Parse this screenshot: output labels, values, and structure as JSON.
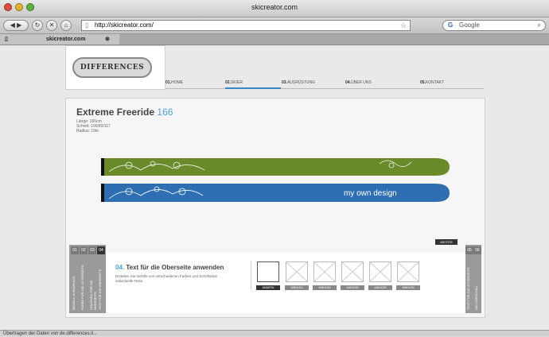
{
  "window": {
    "title": "skicreator.com"
  },
  "toolbar": {
    "url": "http://skicreator.com/",
    "search_placeholder": "Google"
  },
  "tabs": [
    {
      "label": "skicreator.com"
    }
  ],
  "site": {
    "logo_text": "DIFFERENCES",
    "menu": [
      {
        "num": "01.",
        "label": "HOME"
      },
      {
        "num": "02.",
        "label": "SKIER"
      },
      {
        "num": "03.",
        "label": "AUSRÜSTUNG"
      },
      {
        "num": "04.",
        "label": "ÜBER UNS"
      },
      {
        "num": "05.",
        "label": "KONTAKT"
      }
    ]
  },
  "product": {
    "title": "Extreme Freeride",
    "number": "166",
    "specs": [
      "Länge: 166cm",
      "Schnitt: 100/80/117",
      "Radius: 19m"
    ],
    "ski_text": "my own design",
    "colors": {
      "top_ski": "#6b8a2a",
      "bottom_ski": "#2e6fb3",
      "accent": "#4aa3df"
    }
  },
  "configurator": {
    "left_steps": [
      "01",
      "02",
      "03",
      "04"
    ],
    "left_labels": [
      "MODELL AUSWÄHLEN",
      "FARBE FÜR DIE UNTERSEITE",
      "GRAFIKEN FÜR DIE OBERSEITE",
      "TEXT FÜR DIE OBERSEITE"
    ],
    "right_steps": [
      "05",
      "06"
    ],
    "right_labels": [
      "TEXT FÜR DIE UNTERSEITE",
      "SKI-VORSCHAU"
    ],
    "weiter": "WEITER",
    "step_num": "04.",
    "step_title": "Text für die Oberseite anwenden",
    "step_desc": "Erstellen Sie mithilfe von verschiedenen Farben und Schriftarten individuelle Texte.",
    "slot_buttons": [
      "ÄNDERN",
      "WÄHLEN",
      "WÄHLEN",
      "WÄHLEN",
      "WÄHLEN",
      "WÄHLEN"
    ]
  },
  "status": "Übertragen der Daten von de.differences.li..."
}
